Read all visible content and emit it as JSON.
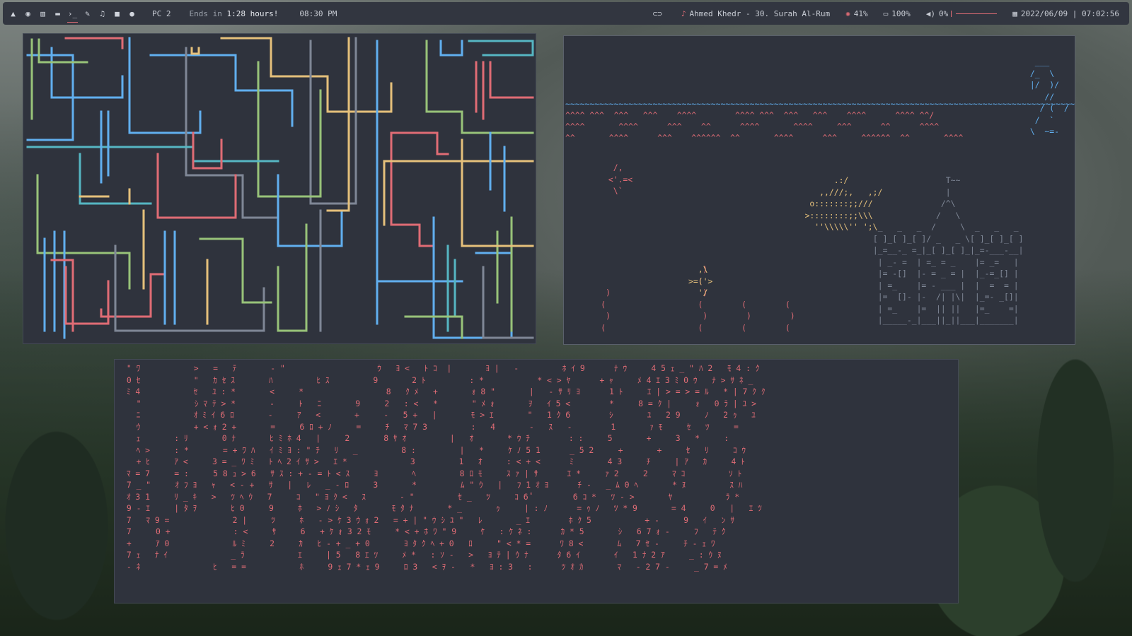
{
  "topbar": {
    "icons": [
      "arch-icon",
      "globe-icon",
      "bank-icon",
      "folder-icon",
      "terminal-icon",
      "edit-icon",
      "music-icon",
      "video-icon",
      "chat-icon"
    ],
    "workspace": "PC 2",
    "ends_prefix": "Ends in ",
    "ends_value": "1:28 hours!",
    "clock_short": "08:30 PM",
    "toggle_icon": "toggle-icon",
    "now_playing": "Ahmed Khedr - 30. Surah Al-Rum",
    "cpu": "41%",
    "battery": "100%",
    "volume": "0%",
    "datetime": "2022/06/09 | 07:02:56"
  },
  "colors": {
    "accent": "#e06c75",
    "blue": "#61afef",
    "green": "#98c379",
    "yellow": "#e5c07b",
    "cyan": "#56b6c2",
    "window_bg": "#2f333d"
  },
  "aquarium": {
    "waves": "^^^^ ^^^  ^^^   ^^^    ^^^^        ^^^^ ^^^  ^^^   ^^^    ^^^^      ^^^^ ^^/"
  },
  "matrix": {
    "rows": [
      " \" ﾜ           >   =   ﾃ       - \"                   ｳ   ﾖ <   ﾄ ｺ  |       ﾖ |   -         ﾎ ｲ 9      ﾅ ｳ     4 5 ｪ _ \" ﾊ 2   ﾓ 4 : ｸ",
      " 0 ｾ           \"   ｶ ｾ ｽ       ﾊ         ﾋ ｽ         9       2 ﾄ         : *           * < > ﾔ      + ｬ     ﾒ 4 ｴ 3 ﾐ 0 ｳ   ﾅ > ｻ ﾈ _",
      " ﾐ 4           ｾ   ﾕ : *       <     *                 8   ｸ ﾒ   +       ｫ 8 \"       |   - ｻ ﾘ ﾖ      1 ﾄ     ｴ | > = > = ﾙ   * | 7 ｸ ｸ",
      "   \"           ｼ ﾏ ﾃ > *       -     ﾄ   ﾆ       9     2   : <   *       \" ﾒ ｫ       ｦ   ｲ 5 <        *     8 = ｸ |     ｫ   0 ﾗ | ﾕ >",
      "   ﾆ           ｵ ﾐ ｲ 6 ﾛ       -     ｱ   <       +     -   5 +   |       ﾓ > ｴ       \"   1 ｸ 6        ｼ       ﾕ   2 9     ﾉ   2 ｩ   ﾕ",
      "   ｳ           + < ｫ 2 +       =     6 ﾛ + ﾉ     =     ﾁ   ﾏ 7 3         :   4       -   ｽ   -        1       ｧ ﾓ     ｾ   ﾂ     =",
      "   ｪ       : ﾘ       0 ﾅ       ﾋ ﾐ ﾎ 4   |     2       8 ｻ ｵ         |   ｵ       * ｳ ﾁ        : :     5       +     3   *     :",
      "   ﾍ >     : *       = + ﾜ ﾊ   ｲ ﾐ ﾖ : \" ﾁ   ﾘ   _         8 :         |   *     ｹ ﾉ 5 1      _ 5 2     +       +     ｾ   ﾘ     ｺ ｳ",
      "   + ﾋ     ｱ <     3 = _ ﾜ ﾐ   ﾄ ﾍ 2 ｲ ｻ >   ｴ *             3         1   ｵ     : < + <      ﾐ       4 3     ﾁ     | ｱ   ｶ     4 ﾄ",
      " ﾏ = 7     = :     5 8 ｭ > 6   ｻ ｽ : + - = ﾄ < ｽ     ﾖ       ﾍ         8 ﾛ ﾓ     ｽ ｧ | ｻ      ｴ *     ｧ 2     2     ﾏ ｺ         ｿ ﾄ",
      " 7 _ \"     ｵ ﾌ ﾖ   ｬ   < - +   ｻ   |   ﾚ   _ - ﾛ     3       *         ﾑ \" ｳ   |   ﾌ 1 ｵ ﾖ      ﾁ -   _ ﾑ 0 ﾍ       * ﾇ         ｽ ﾊ",
      " ｵ 3 1     ﾘ _ ｷ   >   ﾂ ﾍ ｳ   7     ｺ   \" ﾖ ｸ <   ｽ       - \"         ｾ _   ﾂ     ｺ 6 ﾟ        6 ｺ *   ﾂ - >       ﾔ           ﾗ *",
      " 9 - ｴ     | ﾀ ｦ       ﾋ 0     9     ﾎ   > ﾉ ｼ   ﾀ       ﾓ ﾀ ﾅ       * _       ｩ     | : ﾉ      = ｩ ﾉ   ﾂ * 9       = 4     0   |   ｴ ﾂ",
      " 7   ﾏ 9 =             2 |     ﾂ     ﾎ   - > ｹ 3 ｳ ｫ 2   = + | \" ｳ ｼ ﾕ \"   ﾚ       _ ｴ        ﾎ ｸ 5           + -     9   ｲ   ﾝ ｻ",
      " 7     0 +             : <     ｻ     6   + ｹ ｫ 3 2 ﾓ     * < + ﾎ ﾜ \" 9     ｹ   : ｹ ﾈ :      ｶ * 5       ｼ   6 7 ｫ -     ﾌ   ﾃ ｸ",
      " +     ｱ 0             ﾙ ﾐ     2     ｶ   ﾋ - + _ + 0       ﾖ ﾀ ｸ ﾍ + 0   ﾛ     \" < * =      ﾜ 8 <       ﾑ   7 ｾ -     ﾁ - ｪ ﾜ",
      " 7 ｪ   ﾅ ｲ             _ ﾗ           ｴ     | 5   8 ｴ ﾂ     ﾒ *   : ｿ -   >   ﾖ ﾃ | ｳ ﾅ      ﾀ 6 ｲ       ｲ   1 ﾅ 2 ｱ     _ : ｳ ﾇ",
      " - ﾈ               ﾋ   = =           ﾎ     9 ｪ 7 * ｪ 9     ﾛ 3   < ｦ -   *   ﾖ : 3   :      ﾂ ｵ ｶ       ﾏ   - 2 7 -     _ 7 = ﾒ"
    ]
  }
}
